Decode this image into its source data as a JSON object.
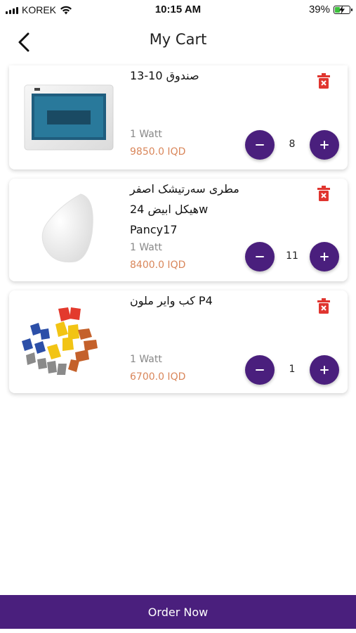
{
  "status_bar": {
    "carrier": "KOREK",
    "time": "10:15 AM",
    "battery_percent": "39%",
    "battery_level": 0.39,
    "icons": [
      "signal-icon",
      "wifi-icon",
      "battery-icon"
    ]
  },
  "header": {
    "title": "My Cart",
    "back_icon": "chevron-left-icon"
  },
  "cart": {
    "items": [
      {
        "name_lines": [
          "صندوق 10-13"
        ],
        "watt": "1 Watt",
        "price": "9850.0 IQD",
        "quantity": "8",
        "image": "distribution-box-image"
      },
      {
        "name_lines": [
          "مطری سەرتیشک اصفر",
          "هیكل ابیض 24w",
          "Pancy17"
        ],
        "watt": "1 Watt",
        "price": "8400.0 IQD",
        "quantity": "11",
        "image": "white-lamp-image"
      },
      {
        "name_lines": [
          "كب واير ملون P4"
        ],
        "watt": "1 Watt",
        "price": "6700.0 IQD",
        "quantity": "1",
        "image": "wire-connectors-image"
      }
    ]
  },
  "footer": {
    "order_label": "Order Now"
  },
  "colors": {
    "primary": "#4a1f7d",
    "price": "#d9865a",
    "delete": "#e0352f",
    "muted": "#888888"
  }
}
